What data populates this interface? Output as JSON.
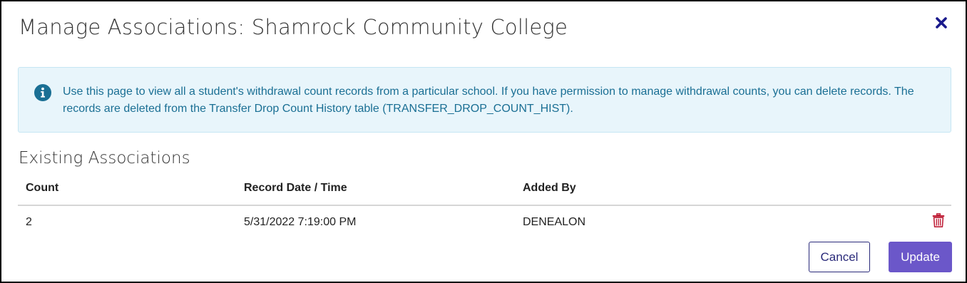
{
  "dialog": {
    "title": "Manage Associations: Shamrock Community College",
    "close_icon": "close-icon"
  },
  "info": {
    "icon": "info-icon",
    "text": "Use this page to view all a student's withdrawal count records from a particular school. If you have permission to manage withdrawal counts, you can delete records. The records are deleted from the Transfer Drop Count History table (TRANSFER_DROP_COUNT_HIST)."
  },
  "associations": {
    "heading": "Existing Associations",
    "columns": {
      "count": "Count",
      "record_date": "Record Date / Time",
      "added_by": "Added By"
    },
    "rows": [
      {
        "count": "2",
        "record_date": "5/31/2022 7:19:00 PM",
        "added_by": "DENEALON",
        "delete_icon": "trash-icon"
      }
    ]
  },
  "actions": {
    "cancel_label": "Cancel",
    "update_label": "Update"
  },
  "colors": {
    "info_background": "#e8f5fb",
    "info_text": "#1a6f94",
    "close_icon": "#1a1a8c",
    "delete_icon": "#c0223a",
    "primary_button": "#6b57c9",
    "secondary_button_border": "#2a2a7a"
  }
}
